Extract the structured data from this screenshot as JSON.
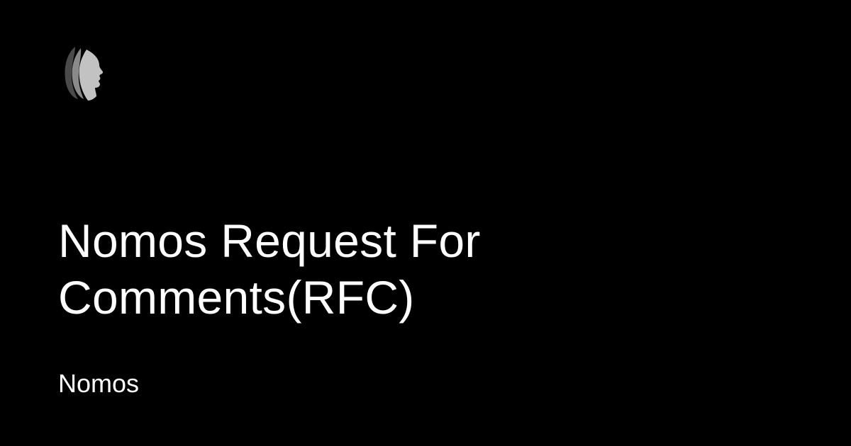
{
  "card": {
    "title": "Nomos Request For Comments(RFC)",
    "site_name": "Nomos"
  },
  "logo": {
    "icon": "face-profile-icon"
  },
  "colors": {
    "background": "#000000",
    "text": "#ffffff",
    "logo_front": "#c2c2c2",
    "logo_middle": "#8a8a8a",
    "logo_back": "#4a4a4a"
  }
}
